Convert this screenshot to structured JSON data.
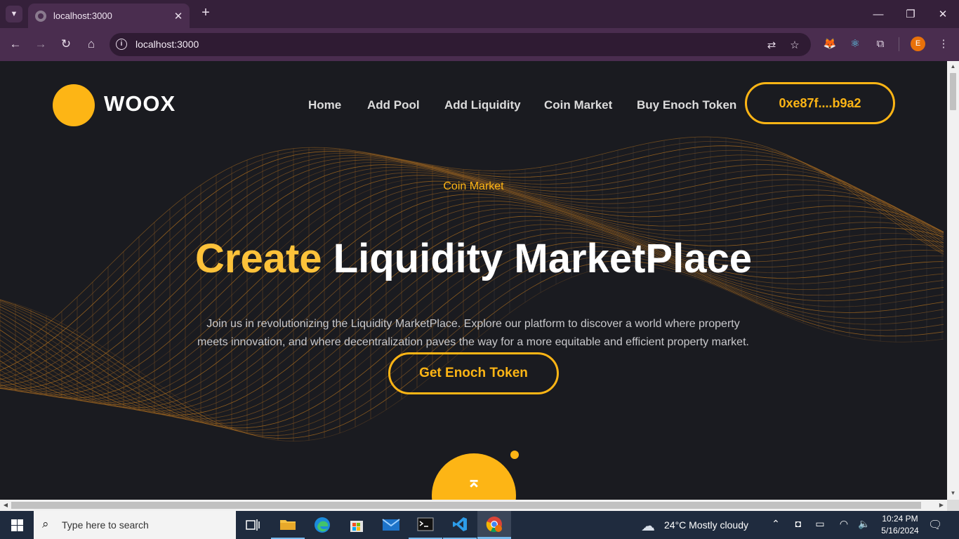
{
  "browser": {
    "tab_title": "localhost:3000",
    "url": "localhost:3000",
    "tab_close": "✕",
    "new_tab": "+",
    "profile_initial": "E"
  },
  "site": {
    "logo": "WOOX",
    "nav": [
      "Home",
      "Add Pool",
      "Add Liquidity",
      "Coin Market",
      "Buy Enoch Token"
    ],
    "wallet": "0xe87f....b9a2",
    "eyebrow": "Coin Market",
    "headline_accent": "Create",
    "headline_rest": " Liquidity MarketPlace",
    "description_line1": "Join us in revolutionizing the Liquidity MarketPlace. Explore our platform to discover a world where property",
    "description_line2": "meets innovation, and where decentralization paves the way for a more equitable and efficient property market.",
    "cta": "Get Enoch Token",
    "scroll_top_icon": "⌅",
    "accent_color": "#fdb515"
  },
  "taskbar": {
    "search_placeholder": "Type here to search",
    "weather": "24°C  Mostly cloudy",
    "time": "10:24 PM",
    "date": "5/16/2024"
  }
}
